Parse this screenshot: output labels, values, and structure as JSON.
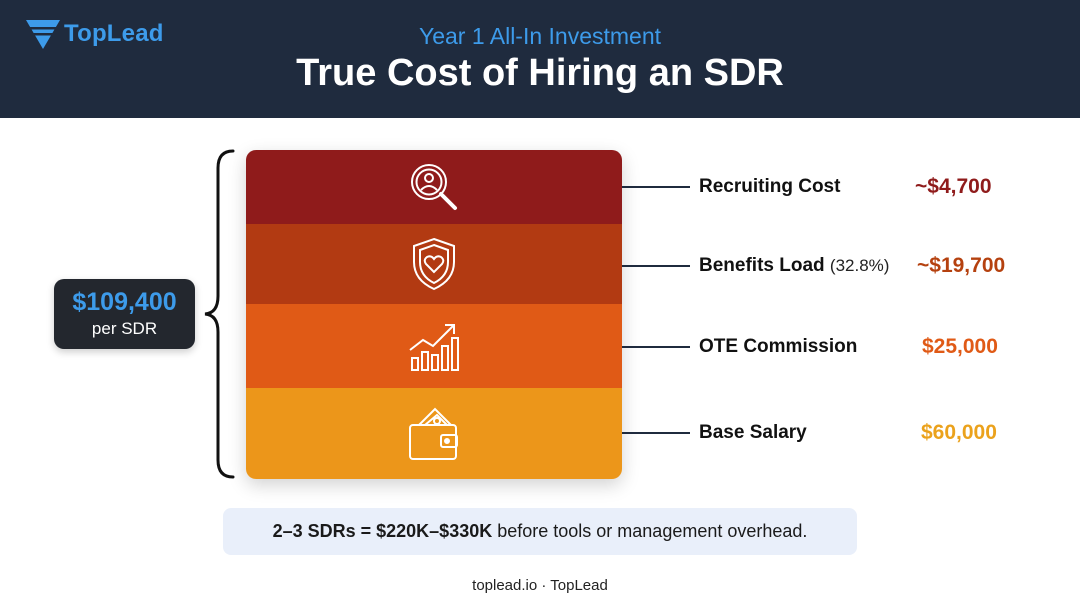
{
  "header": {
    "logo_text": "TopLead",
    "subtitle": "Year 1 All-In Investment",
    "title": "True Cost of Hiring an SDR"
  },
  "total": {
    "amount": "$109,400",
    "label": "per SDR"
  },
  "layers": [
    {
      "label": "Recruiting Cost",
      "note": "",
      "value": "~$4,700",
      "color": "#8f1b1b",
      "value_color": "#8f1b1b",
      "icon": "magnifier-person-icon"
    },
    {
      "label": "Benefits Load",
      "note": "(32.8%)",
      "value": "~$19,700",
      "color": "#b23a12",
      "value_color": "#b5410f",
      "icon": "shield-heart-icon"
    },
    {
      "label": "OTE Commission",
      "note": "",
      "value": "$25,000",
      "color": "#e05a16",
      "value_color": "#e05a16",
      "icon": "growth-chart-icon"
    },
    {
      "label": "Base Salary",
      "note": "",
      "value": "$60,000",
      "color": "#ec961a",
      "value_color": "#eba21c",
      "icon": "wallet-icon"
    }
  ],
  "note": {
    "bold": "2–3 SDRs = $220K–$330K",
    "rest": " before tools or management overhead."
  },
  "footer": "toplead.io · TopLead"
}
